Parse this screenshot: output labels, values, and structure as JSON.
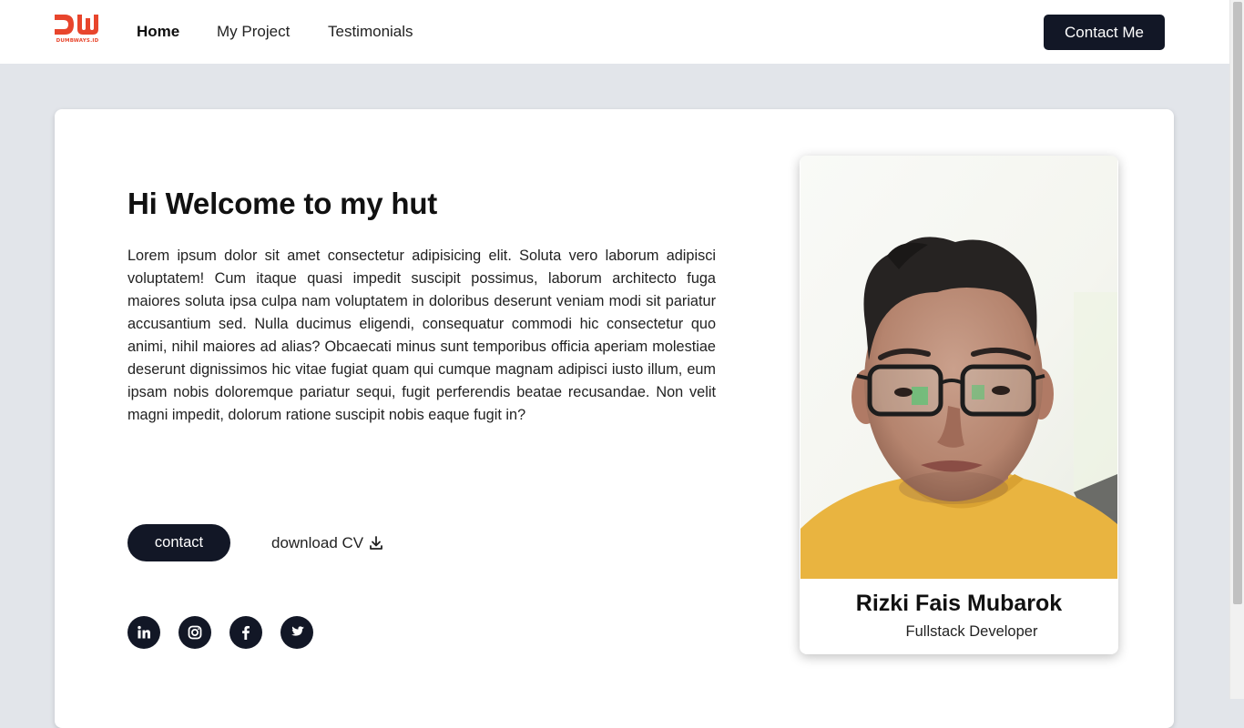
{
  "logo": {
    "text": "DUMBWAYS.ID",
    "icon": "dumbways-logo",
    "color": "#e8452c"
  },
  "nav": {
    "items": [
      {
        "label": "Home",
        "active": true
      },
      {
        "label": "My Project",
        "active": false
      },
      {
        "label": "Testimonials",
        "active": false
      }
    ],
    "contact_label": "Contact Me"
  },
  "hero": {
    "title": "Hi Welcome to my hut",
    "text": "Lorem ipsum dolor sit amet consectetur adipisicing elit. Soluta vero laborum adipisci voluptatem! Cum itaque quasi impedit suscipit possimus, laborum architecto fuga maiores soluta ipsa culpa nam voluptatem in doloribus deserunt veniam modi sit pariatur accusantium sed. Nulla ducimus eligendi, consequatur commodi hic consectetur quo animi, nihil maiores ad alias? Obcaecati minus sunt temporibus officia aperiam molestiae deserunt dignissimos hic vitae fugiat quam qui cumque magnam adipisci iusto illum, eum ipsam nobis doloremque pariatur sequi, fugit perferendis beatae recusandae. Non velit magni impedit, dolorum ratione suscipit nobis eaque fugit in?",
    "contact_label": "contact",
    "download_label": "download CV",
    "download_icon": "download-icon",
    "socials": [
      "linkedin-icon",
      "instagram-icon",
      "facebook-icon",
      "twitter-icon"
    ]
  },
  "profile": {
    "name": "Rizki Fais Mubarok",
    "role": "Fullstack Developer"
  },
  "colors": {
    "dark": "#121726",
    "page_bg": "#e2e5ea",
    "accent": "#e8452c"
  }
}
